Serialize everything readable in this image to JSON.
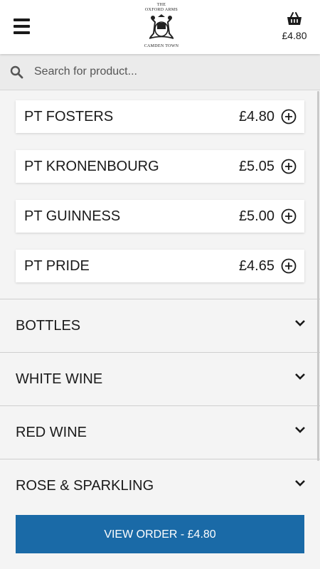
{
  "logo": {
    "line1": "THE",
    "line2": "OXFORD ARMS",
    "line3": "CAMDEN TOWN"
  },
  "basket": {
    "icon": "basket-icon",
    "price": "£4.80"
  },
  "search": {
    "placeholder": "Search for product..."
  },
  "products": [
    {
      "name": "PT FOSTERS",
      "price": "£4.80"
    },
    {
      "name": "PT KRONENBOURG",
      "price": "£5.05"
    },
    {
      "name": "PT GUINNESS",
      "price": "£5.00"
    },
    {
      "name": "PT PRIDE",
      "price": "£4.65"
    }
  ],
  "categories": [
    {
      "label": "BOTTLES"
    },
    {
      "label": "WHITE WINE"
    },
    {
      "label": "RED WINE"
    },
    {
      "label": "ROSE & SPARKLING"
    }
  ],
  "order": {
    "label": "VIEW ORDER  -  £4.80"
  },
  "colors": {
    "accent": "#1a6aa7",
    "background": "#f4f4f4"
  }
}
